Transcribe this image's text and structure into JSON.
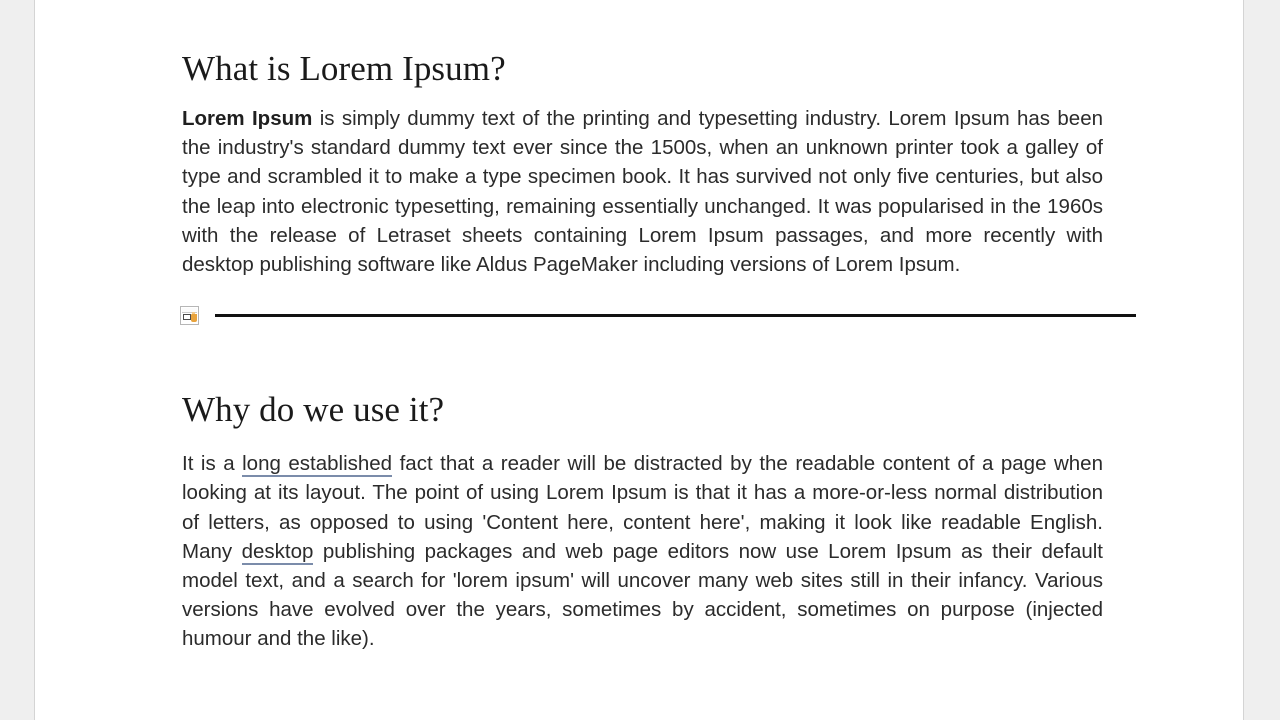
{
  "document": {
    "page_background": "#ffffff",
    "workspace_background": "#efefef",
    "link_underline_color": "#7b8caa",
    "rule_color": "#111111",
    "sections": [
      {
        "heading": "What is Lorem Ipsum?",
        "paragraph_lead": "Lorem Ipsum",
        "paragraph_rest": " is simply dummy text of the printing and typesetting industry. Lorem Ipsum has been the industry's standard dummy text ever since the 1500s, when an unknown printer took a galley of type and scrambled it to make a type specimen book. It has survived not only five centuries, but also the leap into electronic typesetting, remaining essentially unchanged. It was popularised in the 1960s with the release of Letraset sheets containing Lorem Ipsum passages, and more recently with desktop publishing software like Aldus PageMaker including versions of Lorem Ipsum."
      },
      {
        "heading": "Why do we use it?",
        "part_1": "It is a ",
        "link_1": "long established",
        "part_2": " fact that a reader will be distracted by the readable content of a page when looking at its layout. The point of using Lorem Ipsum is that it has a more-or-less normal distribution of letters, as opposed to using 'Content here, content here', making it look like readable English. Many ",
        "link_2": "desktop",
        "part_3": " publishing packages and web page editors now use Lorem Ipsum as their default model text, and a search for 'lorem ipsum' will uncover many web sites still in their infancy. Various versions have evolved over the years, sometimes by accident, sometimes on purpose (injected humour and the like)."
      }
    ],
    "break_marker": {
      "icon": "section-break-icon",
      "accent_color": "#e8a33d"
    }
  }
}
